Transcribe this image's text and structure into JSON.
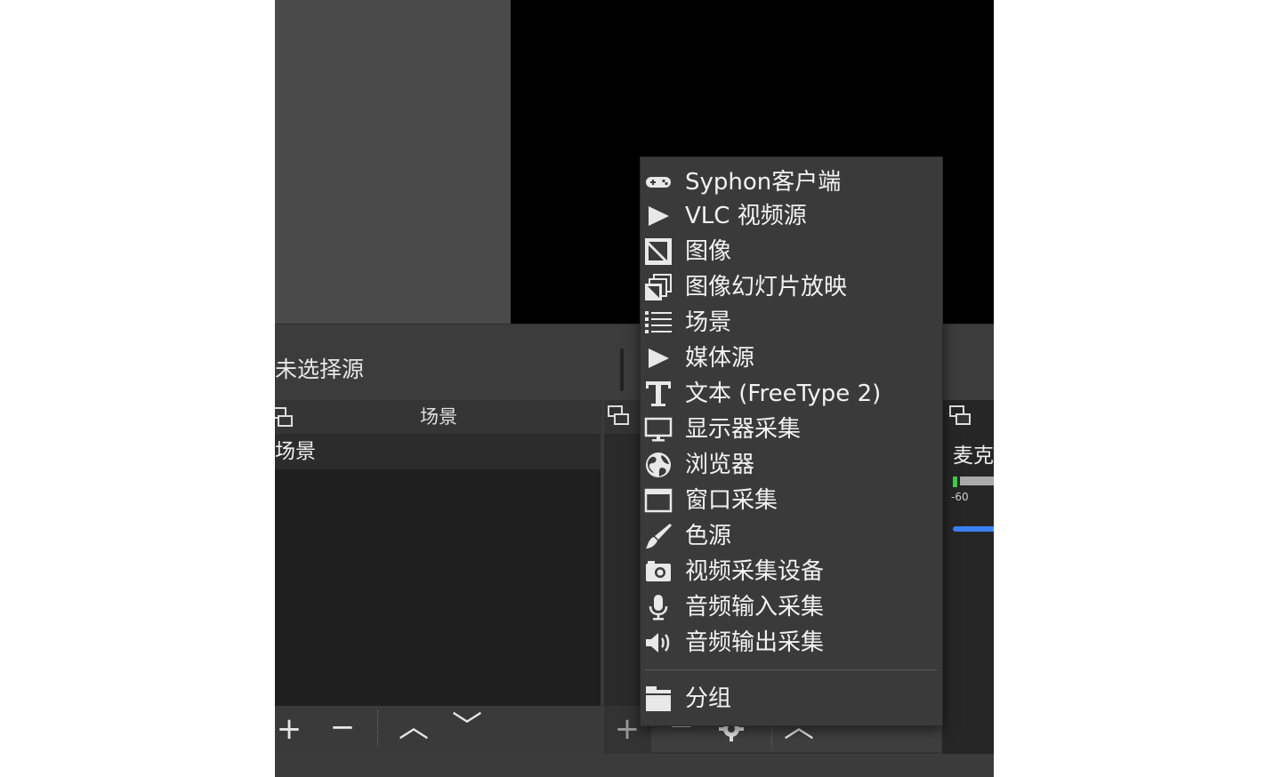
{
  "source_panel": {
    "no_source_label": "未选择源"
  },
  "scenes": {
    "title": "场景",
    "items": [
      {
        "label": "场景"
      }
    ],
    "toolbar": {
      "add": "+",
      "remove": "−",
      "up": "︿",
      "down": "﹀"
    }
  },
  "sources": {
    "toolbar": {
      "add": "+",
      "remove": "−",
      "settings_icon": "gear-icon",
      "up": "︿",
      "down": "﹀"
    }
  },
  "mixer": {
    "label": "麦克",
    "db_label": "-60"
  },
  "context_menu": {
    "items": [
      {
        "label": "Syphon客户端",
        "icon": "gamepad-icon"
      },
      {
        "label": "VLC 视频源",
        "icon": "play-icon"
      },
      {
        "label": "图像",
        "icon": "image-icon"
      },
      {
        "label": "图像幻灯片放映",
        "icon": "slideshow-icon"
      },
      {
        "label": "场景",
        "icon": "list-icon"
      },
      {
        "label": "媒体源",
        "icon": "play-icon"
      },
      {
        "label": "文本 (FreeType 2)",
        "icon": "text-icon"
      },
      {
        "label": "显示器采集",
        "icon": "monitor-icon"
      },
      {
        "label": "浏览器",
        "icon": "globe-icon"
      },
      {
        "label": "窗口采集",
        "icon": "window-icon"
      },
      {
        "label": "色源",
        "icon": "brush-icon"
      },
      {
        "label": "视频采集设备",
        "icon": "camera-icon"
      },
      {
        "label": "音频输入采集",
        "icon": "microphone-icon"
      },
      {
        "label": "音频输出采集",
        "icon": "speaker-icon"
      }
    ],
    "group": {
      "label": "分组",
      "icon": "folder-icon"
    }
  }
}
